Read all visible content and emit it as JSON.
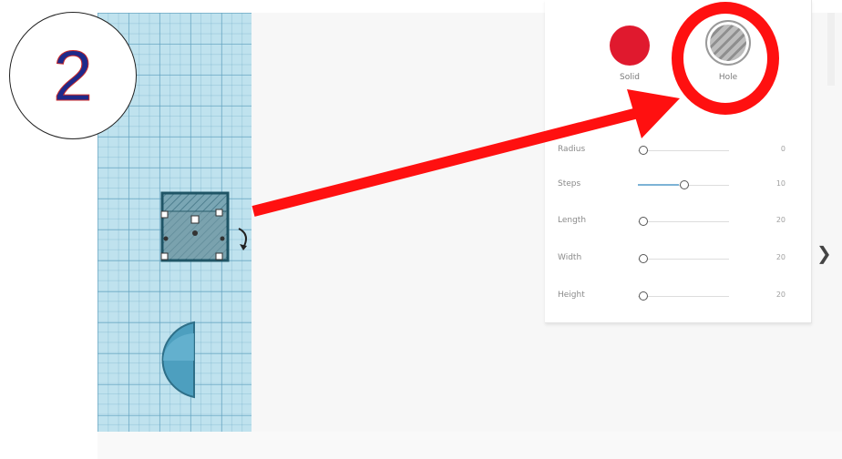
{
  "annotation": {
    "step_number": "2"
  },
  "shape_panel": {
    "solid_label": "Solid",
    "hole_label": "Hole",
    "properties": [
      {
        "label": "Radius",
        "value": "0",
        "level": 0.0
      },
      {
        "label": "Steps",
        "value": "10",
        "level": 0.45
      },
      {
        "label": "Length",
        "value": "20",
        "level": 0.0
      },
      {
        "label": "Width",
        "value": "20",
        "level": 0.0
      },
      {
        "label": "Height",
        "value": "20",
        "level": 0.0
      }
    ]
  },
  "colors": {
    "solid": "#e0192e",
    "highlight": "#ff1010",
    "arrow": "#ff1010",
    "workplane": "#bfe2ee"
  },
  "icons": {
    "expand": "chevron-right-icon",
    "rotate": "rotate-arrow-icon"
  }
}
